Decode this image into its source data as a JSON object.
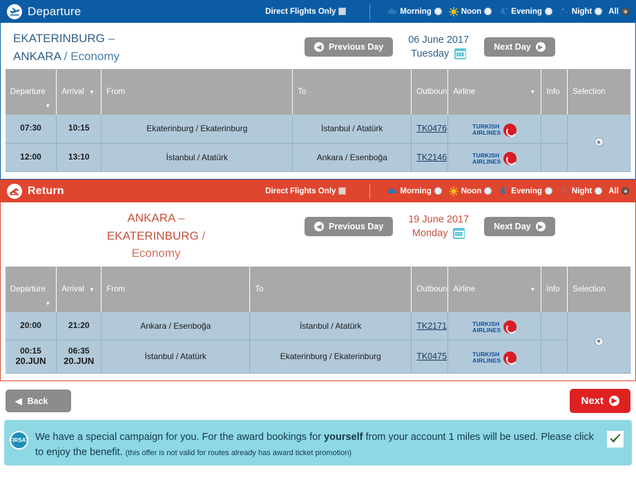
{
  "departure": {
    "bar": {
      "icon": "plane-departure-icon",
      "title": "Departure",
      "direct_label": "Direct Flights Only",
      "direct_checked": false,
      "time_filters": [
        {
          "label": "Morning",
          "icon": "cloud-icon",
          "selected": false
        },
        {
          "label": "Noon",
          "icon": "sun-icon",
          "selected": false
        },
        {
          "label": "Evening",
          "icon": "moon-icon",
          "selected": false
        },
        {
          "label": "Night",
          "icon": "stars-icon",
          "selected": false
        },
        {
          "label": "All",
          "icon": "none",
          "selected": true
        }
      ]
    },
    "route_line1": "EKATERINBURG",
    "route_dash": "–",
    "route_line2": "ANKARA",
    "route_slash": "/",
    "route_cabin": "Economy",
    "prev_day": "Previous Day",
    "next_day": "Next Day",
    "date": "06 June 2017",
    "weekday": "Tuesday",
    "headers": [
      "Departure",
      "Arrival",
      "From",
      "To",
      "Outbound",
      "Airline",
      "Info",
      "Selection"
    ],
    "rows": [
      {
        "departure": "07:30",
        "departure_day": "",
        "arrival": "10:15",
        "arrival_day": "",
        "from": "Ekaterinburg / Ekaterinburg",
        "to": "İstanbul / Atatürk",
        "outbound": "TK0476",
        "airline": "TURKISH AIRLINES",
        "info": ""
      },
      {
        "departure": "12:00",
        "departure_day": "",
        "arrival": "13:10",
        "arrival_day": "",
        "from": "İstanbul / Atatürk",
        "to": "Ankara / Esenboğa",
        "outbound": "TK2146",
        "airline": "TURKISH AIRLINES",
        "info": ""
      }
    ],
    "selection_checked": true
  },
  "return": {
    "bar": {
      "icon": "plane-arrival-icon",
      "title": "Return",
      "direct_label": "Direct Flights Only",
      "direct_checked": false,
      "time_filters": [
        {
          "label": "Morning",
          "icon": "cloud-icon",
          "selected": false
        },
        {
          "label": "Noon",
          "icon": "sun-icon",
          "selected": false
        },
        {
          "label": "Evening",
          "icon": "moon-icon",
          "selected": false
        },
        {
          "label": "Night",
          "icon": "stars-icon",
          "selected": false
        },
        {
          "label": "All",
          "icon": "none",
          "selected": true
        }
      ]
    },
    "route_line1": "ANKARA",
    "route_dash": "–",
    "route_line2": "EKATERINBURG",
    "route_slash": "/",
    "route_cabin": "Economy",
    "prev_day": "Previous Day",
    "next_day": "Next Day",
    "date": "19 June 2017",
    "weekday": "Monday",
    "headers": [
      "Departure",
      "Arrival",
      "From",
      "To",
      "Outbound",
      "Airline",
      "Info",
      "Selection"
    ],
    "rows": [
      {
        "departure": "20:00",
        "departure_day": "",
        "arrival": "21:20",
        "arrival_day": "",
        "from": "Ankara / Esenboğa",
        "to": "İstanbul / Atatürk",
        "outbound": "TK2171",
        "airline": "TURKISH AIRLINES",
        "info": ""
      },
      {
        "departure": "00:15",
        "departure_day": "20.JUN",
        "arrival": "06:35",
        "arrival_day": "20.JUN",
        "from": "İstanbul / Atatürk",
        "to": "Ekaterinburg / Ekaterinburg",
        "outbound": "TK0475",
        "airline": "TURKISH AIRLINES",
        "info": ""
      }
    ],
    "selection_checked": true
  },
  "footer": {
    "back_label": "Back",
    "next_label": "Next"
  },
  "promo": {
    "badge": "FIRSAT",
    "text_1": "We have a special campaign for you. For the award bookings for ",
    "text_bold": "yourself",
    "text_2": " from your account 1 miles will be used. Please click to enjoy the benefit. ",
    "text_fine": "(this offer is not valid for routes already has award ticket promotion)",
    "checked": true
  },
  "colors": {
    "departure_blue": "#0b5ca5",
    "return_red": "#e0452f",
    "header_gray": "#a9a9a9",
    "row_blue": "#b2c9da",
    "next_red": "#e02121",
    "promo_teal": "#8ed8e4",
    "calendar_cyan": "#5bc8d8",
    "turkish_blue": "#0b4e9e",
    "turkish_red": "#d81c26"
  }
}
